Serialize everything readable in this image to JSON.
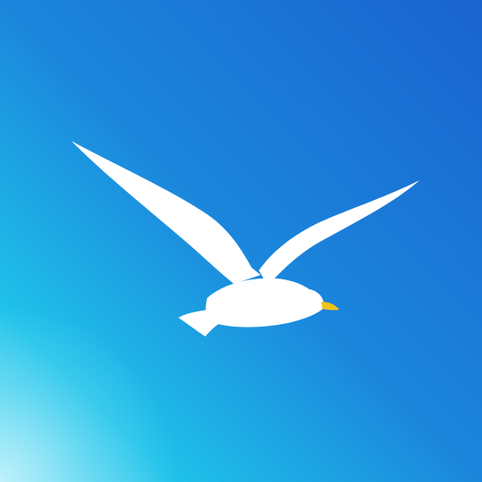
{
  "icon": {
    "name": "seagull-icon",
    "colors": {
      "sky_top_right": "#1a63cf",
      "sky_mid": "#1b86dc",
      "sky_bottom_left": "#1fc2ea",
      "sky_corner_glow": "#8fe6f7",
      "bird": "#ffffff",
      "beak": "#f2c21a"
    }
  }
}
